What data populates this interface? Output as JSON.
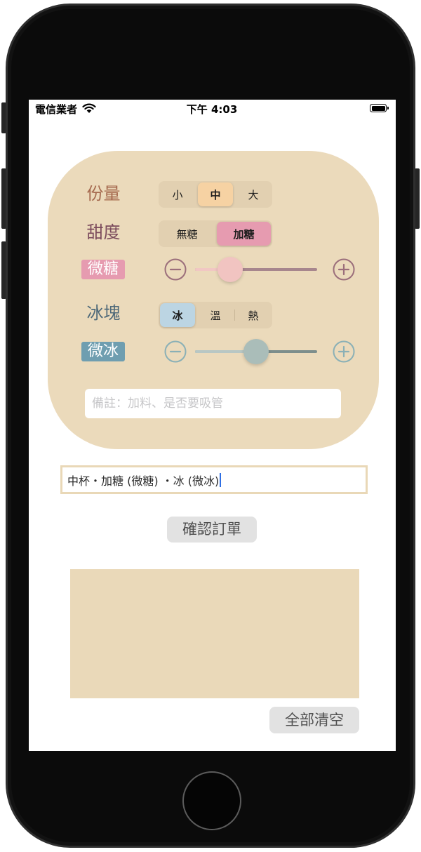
{
  "status_bar": {
    "carrier": "電信業者",
    "time": "下午 4:03",
    "wifi_icon": "wifi-icon",
    "battery_icon": "battery-icon",
    "battery_level": 1.0
  },
  "order_form": {
    "size": {
      "label": "份量",
      "options": [
        "小",
        "中",
        "大"
      ],
      "selected": 1
    },
    "sweetness": {
      "label": "甜度",
      "options": [
        "無糖",
        "加糖"
      ],
      "selected": 1,
      "level_label": "微糖",
      "level": 0.29,
      "decrease_icon": "minus-circle-icon",
      "increase_icon": "plus-circle-icon"
    },
    "ice": {
      "label": "冰塊",
      "options": [
        "冰",
        "溫",
        "熱"
      ],
      "selected": 0,
      "level_label": "微冰",
      "level": 0.5,
      "decrease_icon": "minus-circle-icon",
      "increase_icon": "plus-circle-icon"
    },
    "note": {
      "value": "",
      "placeholder": "備註：加料、是否要吸管"
    }
  },
  "summary": {
    "value": "中杯・加糖 (微糖) ・冰 (微冰)"
  },
  "buttons": {
    "confirm": "確認訂單",
    "clear_all": "全部清空"
  },
  "colors": {
    "card_background": "#ebdabb",
    "segment_background": "#e2d0b1",
    "size_selected": "#f6d2a3",
    "size_label": "#a5694e",
    "sweetness_label": "#7b4b5c",
    "sweetness_accent": "#e69bb0",
    "sweetness_stepper": "#9b6e7b",
    "sweetness_track_min": "#f1c7c3",
    "sweetness_track_max": "#a7868d",
    "sweetness_thumb": "#f1c4c1",
    "ice_label": "#4e6979",
    "ice_selected": "#bcd5e3",
    "ice_accent": "#6f9eb0",
    "ice_stepper": "#8ab0b6",
    "ice_track_min": "#b8c7c4",
    "ice_track_max": "#7d8e8c",
    "ice_thumb": "#aabdb9",
    "button_background": "#e2e2e2",
    "output_background": "#ead9b9"
  }
}
